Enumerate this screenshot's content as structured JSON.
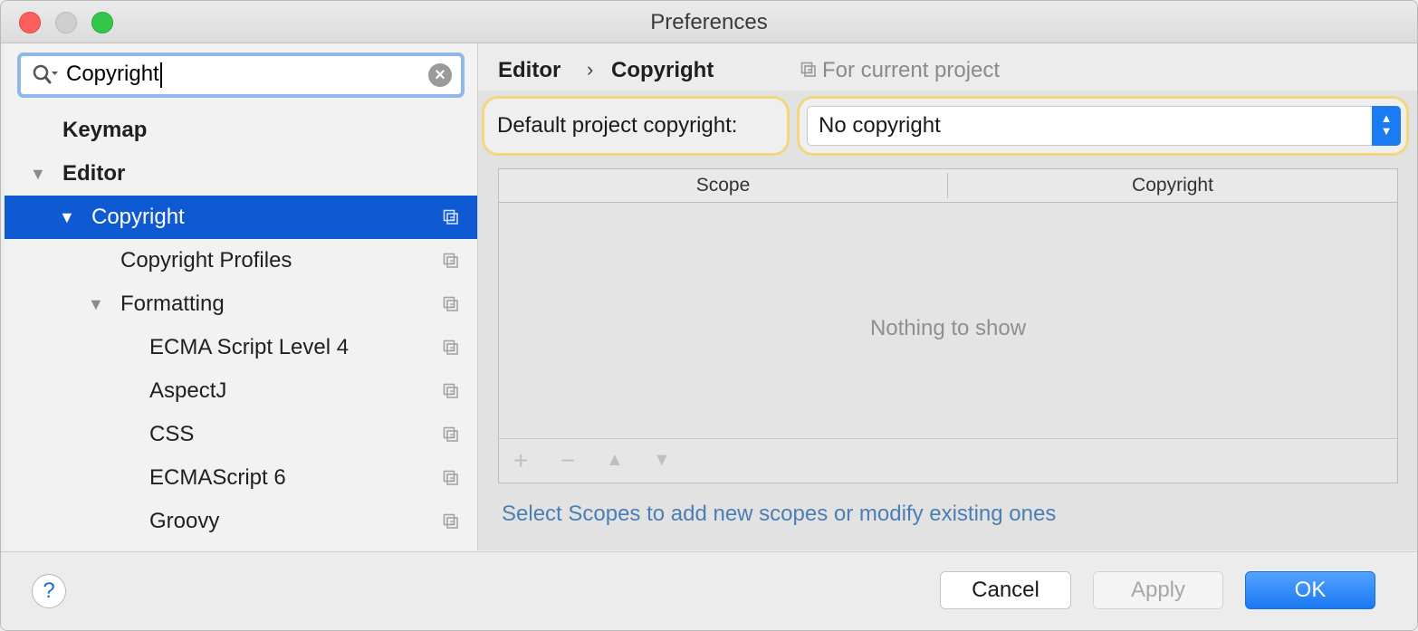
{
  "window": {
    "title": "Preferences"
  },
  "search": {
    "value": "Copyright"
  },
  "tree": [
    {
      "label": "Keymap",
      "bold": true
    },
    {
      "label": "Editor",
      "bold": true
    },
    {
      "label": "Copyright",
      "selected": true
    },
    {
      "label": "Copyright Profiles"
    },
    {
      "label": "Formatting"
    },
    {
      "label": "ECMA Script Level 4"
    },
    {
      "label": "AspectJ"
    },
    {
      "label": "CSS"
    },
    {
      "label": "ECMAScript 6"
    },
    {
      "label": "Groovy"
    }
  ],
  "breadcrumb": {
    "parent": "Editor",
    "separator": "›",
    "current": "Copyright"
  },
  "scope_note": "For current project",
  "default_copyright": {
    "label": "Default project copyright:",
    "value": "No copyright"
  },
  "table": {
    "columns": [
      "Scope",
      "Copyright"
    ],
    "empty_text": "Nothing to show",
    "toolbar": {
      "add": "+",
      "remove": "−",
      "up": "▲",
      "down": "▼"
    }
  },
  "hint_link": "Select Scopes to add new scopes or modify existing ones",
  "buttons": {
    "help": "?",
    "cancel": "Cancel",
    "apply": "Apply",
    "ok": "OK"
  },
  "colors": {
    "selection": "#0f5ad2",
    "highlight": "#f3d77e",
    "link": "#4a7fb5",
    "primary": "#1a78f3"
  }
}
